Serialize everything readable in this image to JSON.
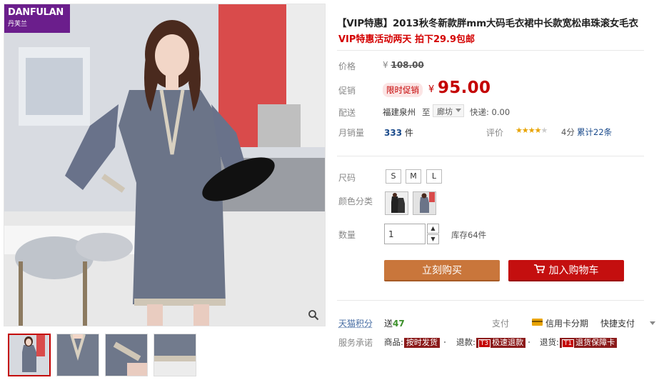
{
  "brand": {
    "name": "DANFULAN",
    "sub": "丹芙兰"
  },
  "gallery": {
    "thumbnails": [
      "thumb-1",
      "thumb-2",
      "thumb-3",
      "thumb-4"
    ],
    "zoom_icon": "magnifier-icon"
  },
  "product": {
    "title": "【VIP特惠】2013秋冬新款胖mm大码毛衣裙中长款宽松串珠滚女毛衣",
    "promo_line": "VIP特惠活动两天 拍下29.9包邮"
  },
  "price": {
    "label": "价格",
    "currency": "¥",
    "original": "108.00",
    "promo_label": "促销",
    "promo_badge": "限时促销",
    "current": "95.00"
  },
  "shipping": {
    "label": "配送",
    "from": "福建泉州",
    "to_label": "至",
    "to_value": "廊坊",
    "express": "快递: 0.00"
  },
  "sales": {
    "label": "月销量",
    "count": "333",
    "unit": "件",
    "rating_label": "评价",
    "stars_filled": 4,
    "stars_total": 5,
    "score": "4分",
    "reviews": "累计22条"
  },
  "size": {
    "label": "尺码",
    "options": [
      "S",
      "M",
      "L"
    ]
  },
  "color": {
    "label": "颜色分类"
  },
  "quantity": {
    "label": "数量",
    "value": "1",
    "stock": "库存64件",
    "up": "▲",
    "down": "▼"
  },
  "actions": {
    "buy_now": "立刻购买",
    "add_to_cart": "加入购物车"
  },
  "points": {
    "label": "天猫积分",
    "prefix": "送",
    "value": "47"
  },
  "payment": {
    "label": "支付",
    "credit": "信用卡分期",
    "quick": "快捷支付"
  },
  "service": {
    "label": "服务承诺",
    "goods_label": "商品:",
    "goods_tag": "按时发货",
    "refund_label": "退款:",
    "refund_code": "T3",
    "refund_tag": "极速退款",
    "return_label": "退货:",
    "return_code": "T1",
    "return_tag": "退货保障卡"
  },
  "colors": {
    "accent_red": "#c40000",
    "buy_orange": "#c9763b",
    "cart_red": "#c40f0f",
    "brand_purple": "#6b1e8c",
    "link_blue": "#1a4a8b"
  }
}
